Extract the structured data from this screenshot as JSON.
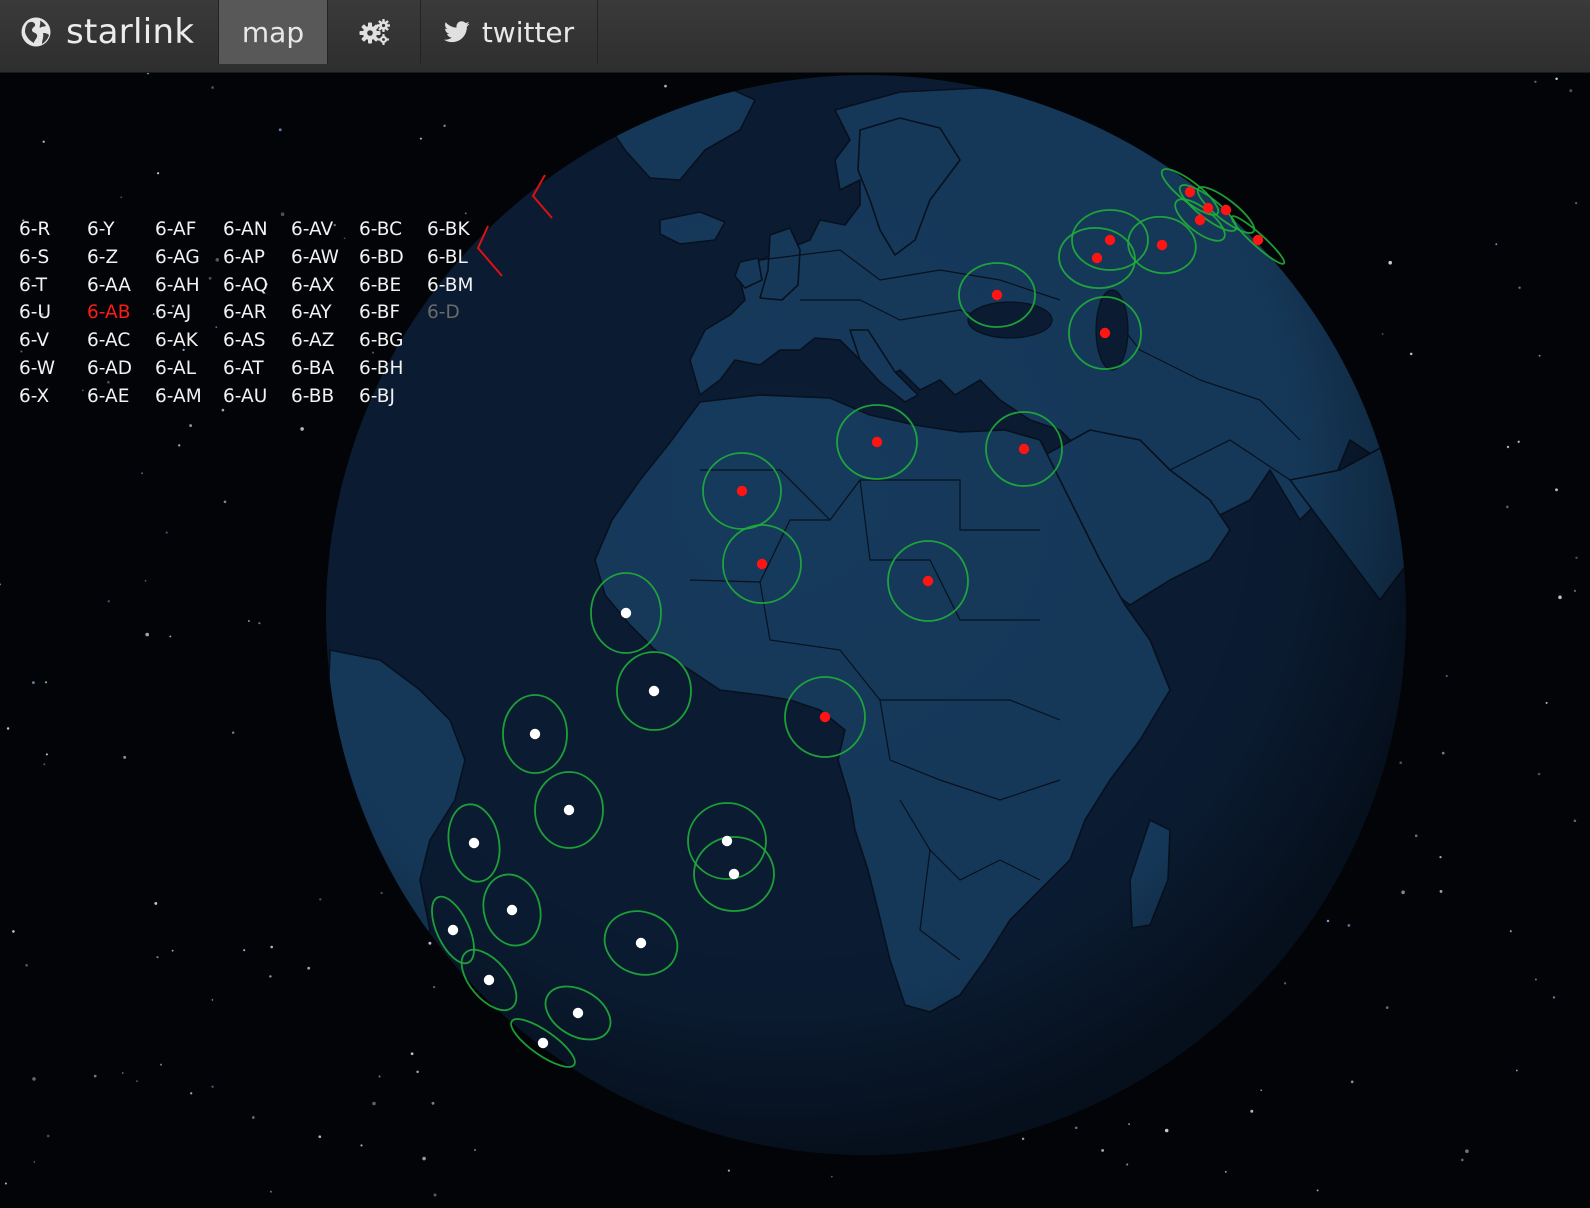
{
  "nav": {
    "brand": "starlink",
    "brand_icon": "globe-icon",
    "items": [
      {
        "label": "map",
        "active": true
      },
      {
        "label": "",
        "icon": "gears-icon"
      },
      {
        "label": "twitter",
        "icon": "twitter-bird-icon"
      }
    ]
  },
  "launches": [
    {
      "label": "6-R"
    },
    {
      "label": "6-S"
    },
    {
      "label": "6-T"
    },
    {
      "label": "6-U"
    },
    {
      "label": "6-V"
    },
    {
      "label": "6-W"
    },
    {
      "label": "6-X"
    },
    {
      "label": "6-Y"
    },
    {
      "label": "6-Z"
    },
    {
      "label": "6-AA"
    },
    {
      "label": "6-AB",
      "state": "active"
    },
    {
      "label": "6-AC"
    },
    {
      "label": "6-AD"
    },
    {
      "label": "6-AE"
    },
    {
      "label": "6-AF"
    },
    {
      "label": "6-AG"
    },
    {
      "label": "6-AH"
    },
    {
      "label": "6-AJ"
    },
    {
      "label": "6-AK"
    },
    {
      "label": "6-AL"
    },
    {
      "label": "6-AM"
    },
    {
      "label": "6-AN"
    },
    {
      "label": "6-AP"
    },
    {
      "label": "6-AQ"
    },
    {
      "label": "6-AR"
    },
    {
      "label": "6-AS"
    },
    {
      "label": "6-AT"
    },
    {
      "label": "6-AU"
    },
    {
      "label": "6-AV"
    },
    {
      "label": "6-AW"
    },
    {
      "label": "6-AX"
    },
    {
      "label": "6-AY"
    },
    {
      "label": "6-AZ"
    },
    {
      "label": "6-BA"
    },
    {
      "label": "6-BB"
    },
    {
      "label": "6-BC"
    },
    {
      "label": "6-BD"
    },
    {
      "label": "6-BE"
    },
    {
      "label": "6-BF"
    },
    {
      "label": "6-BG"
    },
    {
      "label": "6-BH"
    },
    {
      "label": "6-BJ"
    },
    {
      "label": "6-BK"
    },
    {
      "label": "6-BL"
    },
    {
      "label": "6-BM"
    },
    {
      "label": "6-D",
      "state": "dim"
    }
  ],
  "colors": {
    "navbar": "#333333",
    "nav_active": "#585858",
    "space": "#020408",
    "ocean": "#0b1c33",
    "land": "#163a5c",
    "borders": "#07111f",
    "coverage_ring": "#1fae3a",
    "satellite_active": "#ff1414",
    "satellite_other": "#ffffff",
    "launch_active_text": "#ff1a1a",
    "launch_dim_text": "#6a6a6a"
  },
  "globe": {
    "view": "Europe, Africa and the Atlantic",
    "satellite_groups": [
      {
        "group": "6-AB",
        "color": "red"
      },
      {
        "group": "other",
        "color": "white"
      }
    ]
  }
}
